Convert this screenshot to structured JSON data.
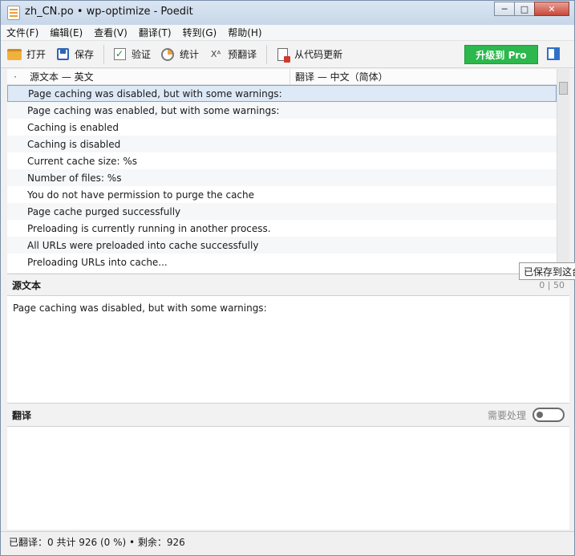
{
  "window": {
    "title": "zh_CN.po • wp-optimize - Poedit",
    "controls": {
      "minimize": "─",
      "maximize": "□",
      "close": "✕"
    }
  },
  "menu": [
    "文件(F)",
    "编辑(E)",
    "查看(V)",
    "翻译(T)",
    "转到(G)",
    "帮助(H)"
  ],
  "toolbar": {
    "open": "打开",
    "save": "保存",
    "validate": "验证",
    "stats": "统计",
    "pretranslate_icon": "Xᴬ",
    "pretranslate": "预翻译",
    "update": "从代码更新",
    "pro": "升级到 Pro"
  },
  "list": {
    "flag_col": "·",
    "source_col": "源文本 — 英文",
    "translation_col": "翻译 — 中文（简体）",
    "rows": [
      "Page caching was disabled, but with some warnings:",
      "Page caching was enabled, but with some warnings:",
      "Caching is enabled",
      "Caching is disabled",
      "Current cache size: %s",
      "Number of files: %s",
      "You do not have permission to purge the cache",
      "Page cache purged successfully",
      "Preloading is currently running in another process.",
      "All URLs were preloaded into cache successfully",
      "Preloading URLs into cache..."
    ]
  },
  "tooltip": "已保存到这台",
  "source": {
    "title": "源文本",
    "counter": "0 | 50",
    "text": "Page caching was disabled, but with some warnings:"
  },
  "translation": {
    "title": "翻译",
    "fuzzy_label": "需要处理"
  },
  "status": "已翻译：0 共计 926 (0 %)  •  剩余：926"
}
